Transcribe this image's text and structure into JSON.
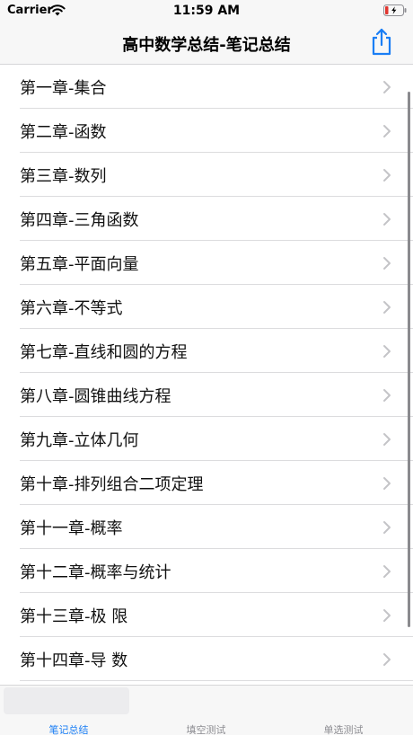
{
  "status_bar": {
    "carrier": "Carrier",
    "time": "11:59 AM"
  },
  "nav": {
    "title": "高中数学总结-笔记总结",
    "share_icon": "share-icon",
    "accent": "#1a7ef5"
  },
  "chapters": [
    {
      "label": "第一章-集合"
    },
    {
      "label": "第二章-函数"
    },
    {
      "label": "第三章-数列"
    },
    {
      "label": "第四章-三角函数"
    },
    {
      "label": "第五章-平面向量"
    },
    {
      "label": "第六章-不等式"
    },
    {
      "label": "第七章-直线和圆的方程"
    },
    {
      "label": "第八章-圆锥曲线方程"
    },
    {
      "label": "第九章-立体几何"
    },
    {
      "label": "第十章-排列组合二项定理"
    },
    {
      "label": "第十一章-概率"
    },
    {
      "label": "第十二章-概率与统计"
    },
    {
      "label": "第十三章-极 限"
    },
    {
      "label": "第十四章-导 数"
    }
  ],
  "tabs": [
    {
      "label": "笔记总结",
      "active": true
    },
    {
      "label": "填空测试",
      "active": false
    },
    {
      "label": "单选测试",
      "active": false
    }
  ]
}
